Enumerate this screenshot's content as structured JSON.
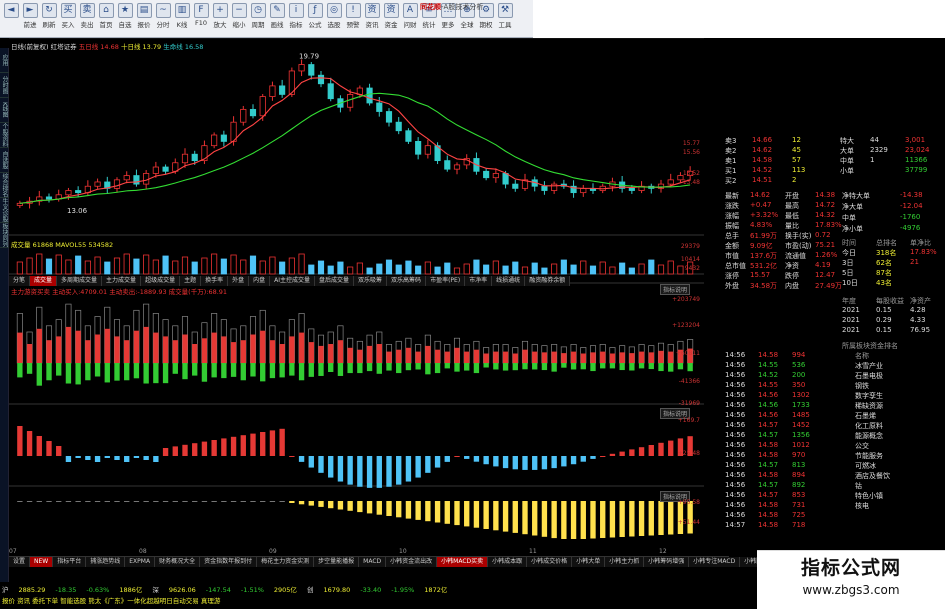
{
  "window": {
    "title_brand": "同花顺",
    "title_rest": "-A股技术分析"
  },
  "toolbar": [
    {
      "name": "back-button",
      "icon": "◄",
      "label": ""
    },
    {
      "name": "forward-button",
      "icon": "►",
      "label": "前进"
    },
    {
      "name": "refresh-button",
      "icon": "↻",
      "label": "刷新"
    },
    {
      "name": "buy-button",
      "icon": "买",
      "label": "买入"
    },
    {
      "name": "sell-button",
      "icon": "卖",
      "label": "卖出"
    },
    {
      "name": "home-button",
      "icon": "⌂",
      "label": "首页"
    },
    {
      "name": "self-select-button",
      "icon": "★",
      "label": "自选"
    },
    {
      "name": "quote-button",
      "icon": "▤",
      "label": "报价"
    },
    {
      "name": "fenshi-button",
      "icon": "~",
      "label": "分时"
    },
    {
      "name": "kline-button",
      "icon": "▥",
      "label": "K线"
    },
    {
      "name": "f10-button",
      "icon": "F",
      "label": "F10"
    },
    {
      "name": "zoom-in-button",
      "icon": "+",
      "label": "放大"
    },
    {
      "name": "zoom-out-button",
      "icon": "−",
      "label": "缩小"
    },
    {
      "name": "cycle-button",
      "icon": "◷",
      "label": "周期"
    },
    {
      "name": "draw-button",
      "icon": "✎",
      "label": "画线"
    },
    {
      "name": "index-button",
      "icon": "i",
      "label": "指标"
    },
    {
      "name": "formula-button",
      "icon": "ƒ",
      "label": "公式"
    },
    {
      "name": "select-stock-button",
      "icon": "◎",
      "label": "选股"
    },
    {
      "name": "warning-button",
      "icon": "!",
      "label": "预警"
    },
    {
      "name": "news-button",
      "icon": "资",
      "label": "资讯"
    },
    {
      "name": "funds-button",
      "icon": "资",
      "label": "资金"
    },
    {
      "name": "ai-button",
      "icon": "A",
      "label": "问财"
    },
    {
      "name": "stat-button",
      "icon": "≡",
      "label": "统计"
    },
    {
      "name": "more-button",
      "icon": "…",
      "label": "更多"
    },
    {
      "name": "global-button",
      "icon": "⊕",
      "label": "全球"
    },
    {
      "name": "options-button",
      "icon": "⚙",
      "label": "期权"
    },
    {
      "name": "tools-button",
      "icon": "⚒",
      "label": "工具"
    }
  ],
  "left_strip": [
    "应用",
    "分时图",
    "K线图",
    "个股资料",
    "自选股",
    "综合排名",
    "牛叉诊股",
    "板块同列"
  ],
  "kline": {
    "title": "日线(前复权)  红塔证券",
    "ma5": "五日线 14.68",
    "ma10": "十日线 13.79",
    "ma60": "生命线 16.58",
    "axis": [
      "15.77",
      "15.56",
      "13.52",
      "13.48"
    ],
    "high_label": "19.79",
    "low_label": "13.06"
  },
  "volume": {
    "title": "成交量 61868   MAVOL55 534582",
    "axis": [
      "29379",
      "10414",
      "9432"
    ]
  },
  "tabs1": [
    "分笔",
    "成交量",
    "多周期成交量",
    "主力成交量",
    "超级成交量",
    "主题",
    "换手率",
    "外盘",
    "内盘",
    "AI主控成交量",
    "盘后成交量",
    "双乐吸筹",
    "双乐高筹码",
    "市盈率(PE)",
    "市净率",
    "线损通统",
    "融资融券余额"
  ],
  "ind1": {
    "title": "主力游资买卖  主动买入:4709.01  主动卖出:-1889.93  成交量(千万):68.91",
    "axis": [
      "+203749",
      "+123204",
      "+60811",
      "-41366",
      "-31969"
    ],
    "btn": "指标说明"
  },
  "ind2": {
    "axis": [
      "+169.7",
      "+25.48"
    ],
    "btn": "指标说明"
  },
  "ind3": {
    "axis": [
      "+95.58",
      "+51.44"
    ],
    "btn": "指标说明"
  },
  "xaxis": [
    "07",
    "08",
    "09",
    "10",
    "11",
    "12"
  ],
  "bottom_tabs": [
    "设置",
    "NEW",
    "指标平台",
    "捕涨趋势线",
    "EXPMA",
    "财务概况大全",
    "资金指数年报到付",
    "梅花主力资金实测",
    "步空量能播报",
    "MACD",
    "小韩资金流出改",
    "小韩MACD买卖",
    "小韩成本跟",
    "小韩成交价格",
    "小韩大单",
    "小韩主力抓",
    "小韩筹码增强",
    "小韩专注MACD",
    "小韩阻压"
  ],
  "quote": {
    "rows": [
      {
        "l": "卖3",
        "v": "14.66",
        "q": "12"
      },
      {
        "l": "卖2",
        "v": "14.62",
        "q": "45"
      },
      {
        "l": "卖1",
        "v": "14.58",
        "q": "57"
      },
      {
        "l": "买1",
        "v": "14.52",
        "q": "113"
      },
      {
        "l": "买2",
        "v": "14.51",
        "q": "2"
      }
    ],
    "stats": [
      {
        "l": "最新",
        "v": "14.62",
        "l2": "开盘",
        "v2": "14.38"
      },
      {
        "l": "涨跌",
        "v": "+0.47",
        "l2": "最高",
        "v2": "14.72"
      },
      {
        "l": "涨幅",
        "v": "+3.32%",
        "l2": "最低",
        "v2": "14.32"
      },
      {
        "l": "振幅",
        "v": "4.83%",
        "l2": "量比",
        "v2": "17.83%"
      },
      {
        "l": "总手",
        "v": "61.99万",
        "l2": "换手(实)",
        "v2": "0.72"
      },
      {
        "l": "金额",
        "v": "9.09亿",
        "l2": "市盈(动)",
        "v2": "75.21"
      },
      {
        "l": "市值",
        "v": "137.6万",
        "l2": "流通值",
        "v2": "1.26%"
      },
      {
        "l": "总市值",
        "v": "531.2亿",
        "l2": "净资",
        "v2": "4.19"
      },
      {
        "l": "涨停",
        "v": "15.57",
        "l2": "跌停",
        "v2": "12.47"
      },
      {
        "l": "外盘",
        "v": "34.58万",
        "l2": "内盘",
        "v2": "27.49万"
      }
    ]
  },
  "bigorder": [
    {
      "l": "特大",
      "v": "44",
      "b": "3,001"
    },
    {
      "l": "大单",
      "v": "2329",
      "b": "23,024"
    },
    {
      "l": "中单",
      "v": "1",
      "b": "11366"
    },
    {
      "l": "小单",
      "v": "",
      "b": "37799"
    }
  ],
  "flow": [
    {
      "l": "净特大单",
      "v": "-14.38"
    },
    {
      "l": "净大单",
      "v": "-12.04"
    },
    {
      "l": "中单",
      "v": "-1760"
    },
    {
      "l": "净小单",
      "v": "-4976"
    }
  ],
  "rank": {
    "header": [
      "时间",
      "总排名",
      "单净比"
    ],
    "rows": [
      {
        "t": "今日",
        "r": "318名",
        "p": "17.83%"
      },
      {
        "t": "3日",
        "r": "62名",
        "p": "21"
      },
      {
        "t": "5日",
        "r": "87名",
        "p": ""
      },
      {
        "t": "10日",
        "r": "43名",
        "p": ""
      }
    ]
  },
  "finance": {
    "header": [
      "年度",
      "每股收益",
      "净资产"
    ],
    "rows": [
      {
        "y": "2021",
        "a": "0.15",
        "b": "4.28"
      },
      {
        "y": "2021",
        "a": "0.29",
        "b": "4.33"
      },
      {
        "y": "2021",
        "a": "0.15",
        "b": "76.95"
      }
    ]
  },
  "ticks": [
    {
      "t": "14:56",
      "p": "14.58",
      "v": "994",
      "c": "red"
    },
    {
      "t": "14:56",
      "p": "14.55",
      "v": "536",
      "c": "green"
    },
    {
      "t": "14:56",
      "p": "14.52",
      "v": "200",
      "c": "green"
    },
    {
      "t": "14:56",
      "p": "14.55",
      "v": "350",
      "c": "red"
    },
    {
      "t": "14:56",
      "p": "14.56",
      "v": "1302",
      "c": "red"
    },
    {
      "t": "14:56",
      "p": "14.56",
      "v": "1733",
      "c": "green"
    },
    {
      "t": "14:56",
      "p": "14.56",
      "v": "1485",
      "c": "red"
    },
    {
      "t": "14:56",
      "p": "14.57",
      "v": "1452",
      "c": "red"
    },
    {
      "t": "14:56",
      "p": "14.57",
      "v": "1356",
      "c": "green"
    },
    {
      "t": "14:56",
      "p": "14.58",
      "v": "1012",
      "c": "red"
    },
    {
      "t": "14:56",
      "p": "14.58",
      "v": "970",
      "c": "red"
    },
    {
      "t": "14:56",
      "p": "14.57",
      "v": "813",
      "c": "green"
    },
    {
      "t": "14:56",
      "p": "14.58",
      "v": "894",
      "c": "red"
    },
    {
      "t": "14:56",
      "p": "14.57",
      "v": "892",
      "c": "green"
    },
    {
      "t": "14:56",
      "p": "14.57",
      "v": "853",
      "c": "red"
    },
    {
      "t": "14:56",
      "p": "14.58",
      "v": "731",
      "c": "red"
    },
    {
      "t": "14:56",
      "p": "14.58",
      "v": "725",
      "c": "red"
    },
    {
      "t": "14:57",
      "p": "14.58",
      "v": "718",
      "c": "red"
    }
  ],
  "sector": {
    "title": "所属板块资金排名",
    "items": [
      "名称",
      "冰雪产业",
      "石墨电极",
      "钢铁",
      "数字孪生",
      "稀缺资源",
      "石墨烯",
      "化工原料",
      "能源概念",
      "公交",
      "节能服务",
      "可燃冰",
      "酒店及餐饮",
      "钴",
      "特色小镇",
      "核电"
    ]
  },
  "status": {
    "row1": [
      "沪",
      "2885.29",
      "-18.35",
      "-0.63%",
      "1886亿",
      "深",
      "9626.06",
      "-147.54",
      "-1.51%",
      "2905亿",
      "创",
      "1679.80",
      "-33.40",
      "-1.95%",
      "1872亿"
    ],
    "row2": "报价  资讯  委托下单  智能选股  熊太《广东》一体化超越明日自动交易   真理游"
  },
  "watermark": {
    "title": "指标公式网",
    "url": "www.zbgs3.com"
  },
  "colors": {
    "up": "#ee3333",
    "down": "#33cccc",
    "vol_down": "#4fc3f7",
    "green_bar": "#33cc33",
    "red_bar": "#e53935",
    "yellow_bar": "#ffe14d",
    "ma_red": "#ff4444",
    "ma_green": "#33dd33"
  },
  "chart_data": {
    "type": "candlestick",
    "closes": [
      13.1,
      13.2,
      13.4,
      13.3,
      13.5,
      13.7,
      13.6,
      13.9,
      14.1,
      13.8,
      14.2,
      14.4,
      14.0,
      14.5,
      14.8,
      14.6,
      15.0,
      15.4,
      15.1,
      15.8,
      16.3,
      16.0,
      16.9,
      17.5,
      17.2,
      18.1,
      18.6,
      18.2,
      19.3,
      19.6,
      19.1,
      18.7,
      18.0,
      17.6,
      18.2,
      18.5,
      17.8,
      17.4,
      16.9,
      16.5,
      16.0,
      15.4,
      15.8,
      15.1,
      14.7,
      14.9,
      15.2,
      14.6,
      14.3,
      14.5,
      14.0,
      13.8,
      14.2,
      13.9,
      13.7,
      14.0,
      13.9,
      13.6,
      13.8,
      13.7,
      13.9,
      14.1,
      13.8,
      13.7,
      13.9,
      13.8,
      14.0,
      14.2,
      14.4,
      14.6
    ],
    "ind1": [
      0.8,
      0.5,
      0.9,
      0.6,
      0.7,
      0.95,
      0.85,
      0.6,
      0.75,
      0.9,
      0.7,
      0.6,
      0.85,
      0.95,
      0.8,
      0.7,
      0.6,
      0.75,
      0.5,
      0.65,
      0.8,
      0.7,
      0.55,
      0.6,
      0.75,
      0.85,
      0.6,
      0.5,
      0.7,
      0.8,
      0.55,
      0.45,
      0.5,
      0.6,
      0.4,
      0.35,
      0.45,
      0.5,
      0.3,
      0.35,
      0.4,
      0.3,
      0.45,
      0.35,
      0.3,
      0.4,
      0.3,
      0.35,
      0.25,
      0.3,
      0.3,
      0.25,
      0.35,
      0.3,
      0.28,
      0.3,
      0.26,
      0.3,
      0.25,
      0.28,
      0.3,
      0.25,
      0.28,
      0.26,
      0.3,
      0.28,
      0.32,
      0.3,
      0.35,
      0.38
    ]
  }
}
